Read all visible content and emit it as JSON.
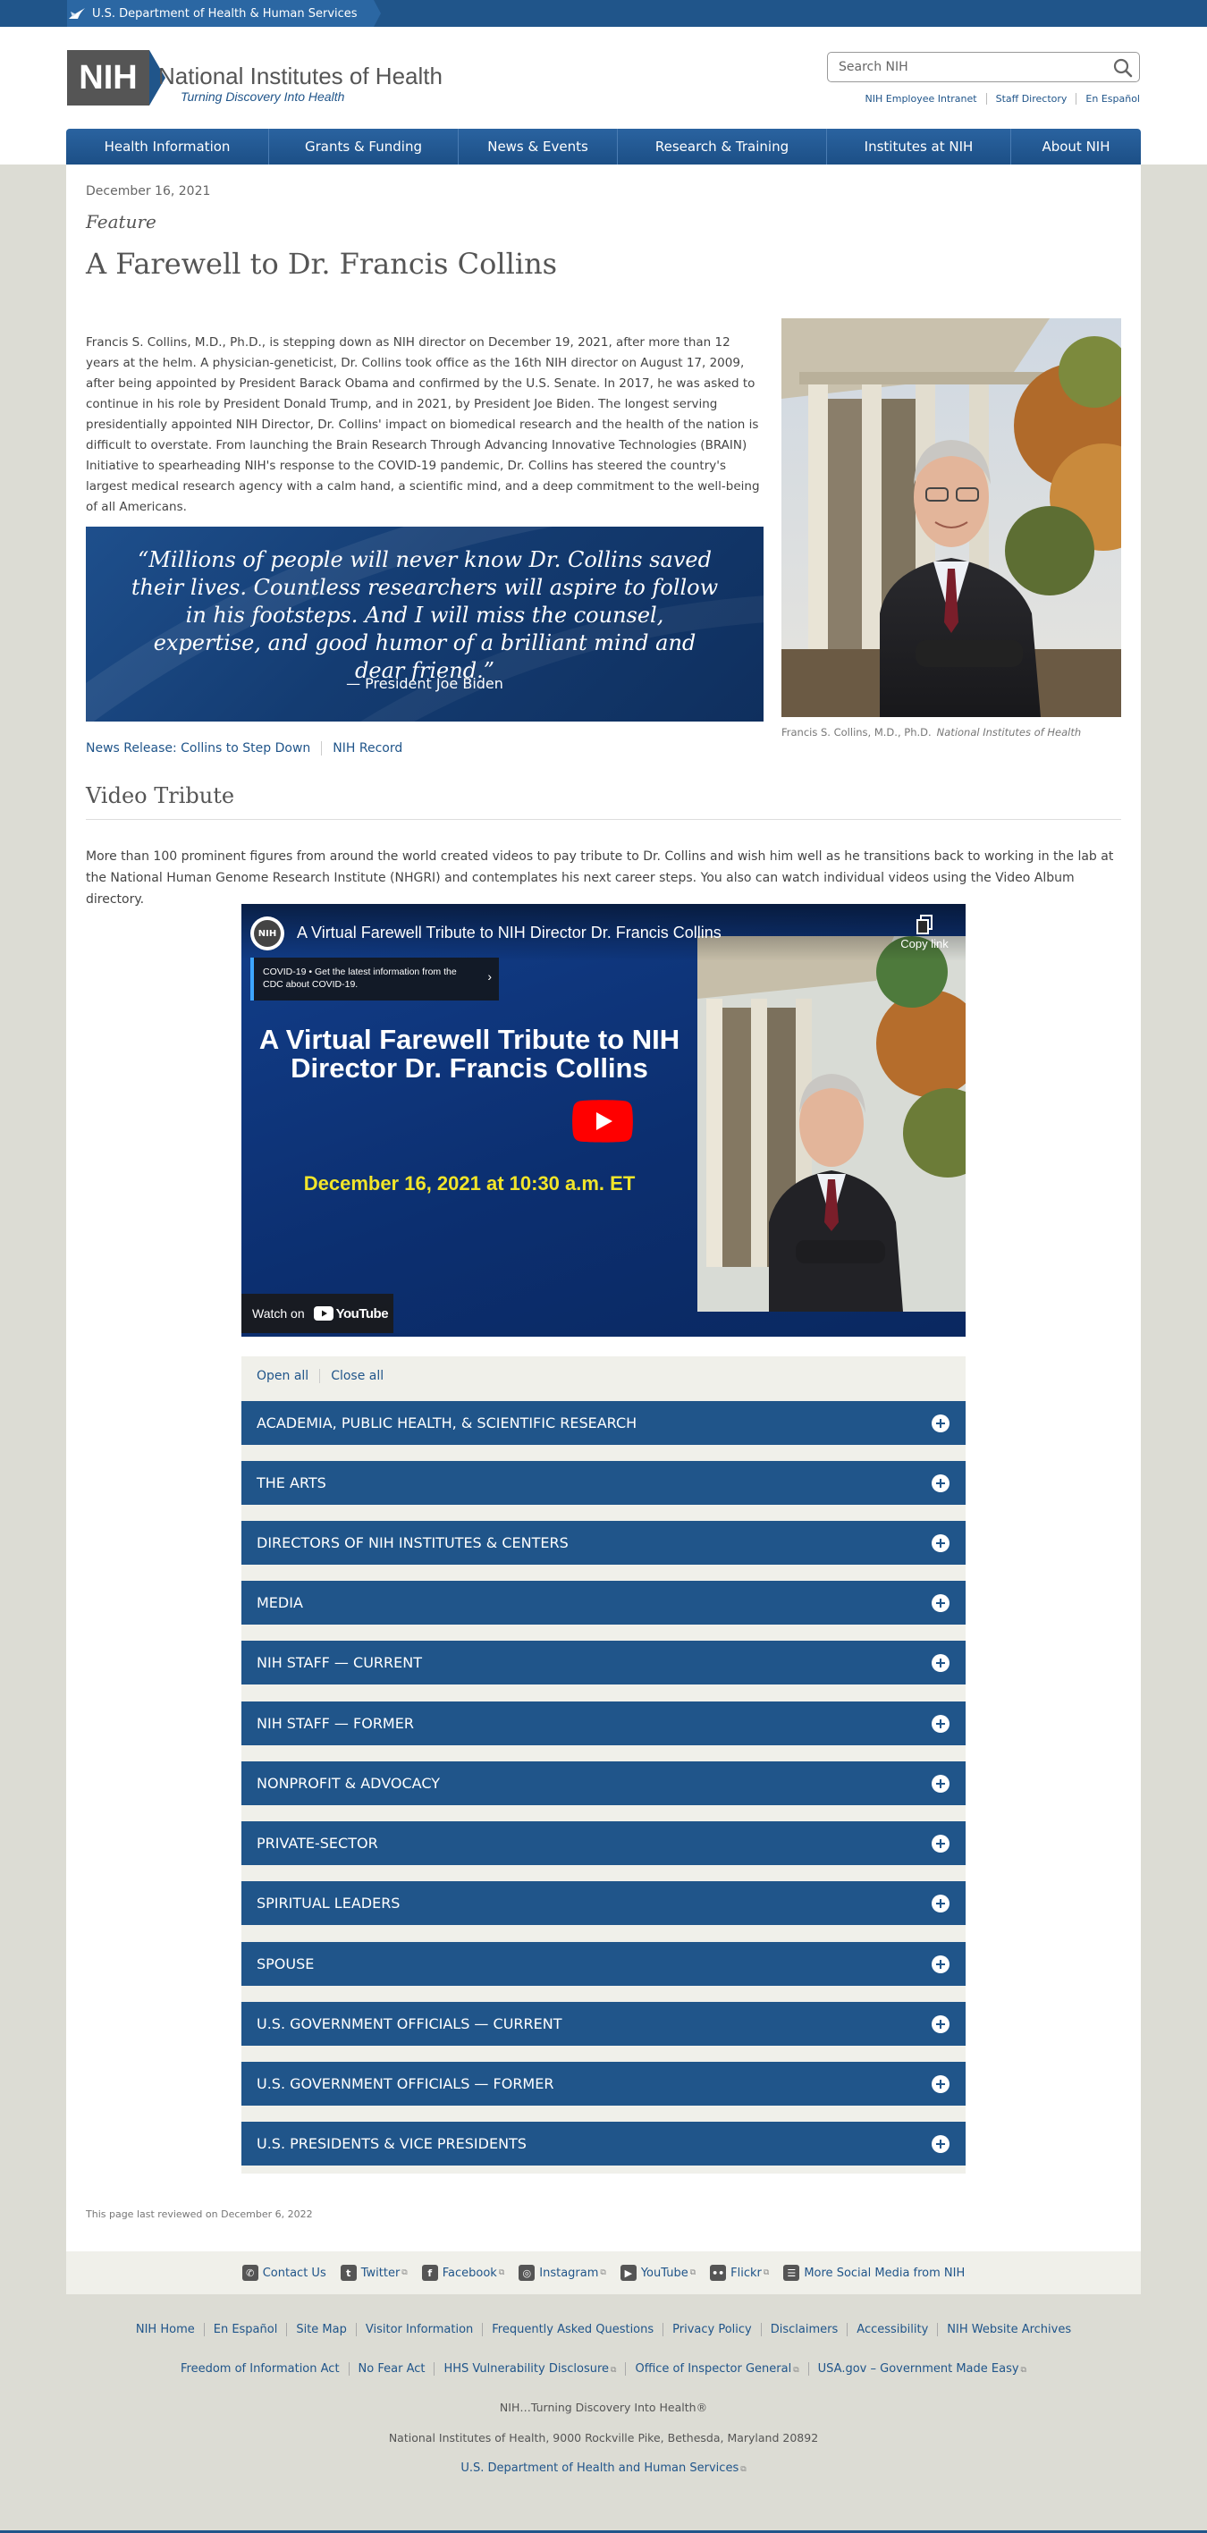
{
  "hhs_bar": {
    "label": "U.S. Department of Health & Human Services"
  },
  "header": {
    "logo_abbr": "NIH",
    "logo_title": "National Institutes of Health",
    "logo_tagline": "Turning Discovery Into Health",
    "search": {
      "placeholder": "Search NIH"
    },
    "utility_links": [
      "NIH Employee Intranet",
      "Staff Directory",
      "En Español"
    ]
  },
  "nav": {
    "items": [
      "Health Information",
      "Grants & Funding",
      "News & Events",
      "Research & Training",
      "Institutes at NIH",
      "About NIH"
    ]
  },
  "article": {
    "date": "December 16, 2021",
    "category": "Feature",
    "title": "A Farewell to Dr. Francis Collins",
    "intro": "Francis S. Collins, M.D., Ph.D., is stepping down as NIH director on December 19, 2021, after more than 12 years at the helm. A physician-geneticist, Dr. Collins took office as the 16th NIH director on August 17, 2009, after being appointed by President Barack Obama and confirmed by the U.S. Senate. In 2017, he was asked to continue in his role by President Donald Trump, and in 2021, by President Joe Biden. The longest serving presidentially appointed NIH Director, Dr. Collins' impact on biomedical research and the health of the nation is difficult to overstate. From launching the Brain Research Through Advancing Innovative Technologies (BRAIN) Initiative to spearheading NIH's response to the COVID-19 pandemic, Dr. Collins has steered the country's largest medical research agency with a calm hand, a scientific mind, and a deep commitment to the well-being of all Americans.",
    "photo_caption": "Francis S. Collins, M.D., Ph.D.",
    "photo_credit": "National Institutes of Health",
    "quote": "“Millions of people will never know Dr. Collins saved their lives. Countless researchers will aspire to follow in his footsteps. And I will miss the counsel, expertise, and good humor of a brilliant mind and dear friend.”",
    "quote_attribution": "— President Joe Biden",
    "links": [
      "News Release: Collins to Step Down",
      "NIH Record"
    ]
  },
  "video_section": {
    "heading": "Video Tribute",
    "text": "More than 100 prominent figures from around the world created videos to pay tribute to Dr. Collins and wish him well as he transitions back to working in the lab at the National Human Genome Research Institute (NHGRI) and contemplates his next career steps. You also can watch individual videos using the Video Album directory.",
    "video": {
      "channel": "NIH",
      "title": "A Virtual Farewell Tribute to NIH Director Dr. Francis Collins",
      "copy_link": "Copy link",
      "covid_banner": "COVID-19 • Get the latest information from the CDC about COVID-19.",
      "headline": "A Virtual Farewell Tribute to NIH Director Dr. Francis Collins",
      "event_date": "December 16, 2021 at 10:30 a.m. ET",
      "watch_on": "Watch on",
      "youtube": "YouTube"
    },
    "accordion_controls": [
      "Open all",
      "Close all"
    ],
    "accordion": [
      "ACADEMIA, PUBLIC HEALTH, & SCIENTIFIC RESEARCH",
      "THE ARTS",
      "DIRECTORS OF NIH INSTITUTES & CENTERS",
      "MEDIA",
      "NIH STAFF — CURRENT",
      "NIH STAFF — FORMER",
      "NONPROFIT & ADVOCACY",
      "PRIVATE-SECTOR",
      "SPIRITUAL LEADERS",
      "SPOUSE",
      "U.S. GOVERNMENT OFFICIALS — CURRENT",
      "U.S. GOVERNMENT OFFICIALS — FORMER",
      "U.S. PRESIDENTS & VICE PRESIDENTS"
    ]
  },
  "reviewed": "This page last reviewed on December 6, 2022",
  "social": [
    {
      "label": "Contact Us",
      "icon": "phone-icon",
      "external": false
    },
    {
      "label": "Twitter",
      "icon": "twitter-icon",
      "external": true
    },
    {
      "label": "Facebook",
      "icon": "facebook-icon",
      "external": true
    },
    {
      "label": "Instagram",
      "icon": "instagram-icon",
      "external": true
    },
    {
      "label": "YouTube",
      "icon": "youtube-icon",
      "external": true
    },
    {
      "label": "Flickr",
      "icon": "flickr-icon",
      "external": true
    },
    {
      "label": "More Social Media from NIH",
      "icon": "social-media-icon",
      "external": false
    }
  ],
  "footer": {
    "row1": [
      "NIH Home",
      "En Español",
      "Site Map",
      "Visitor Information",
      "Frequently Asked Questions",
      "Privacy Policy",
      "Disclaimers",
      "Accessibility",
      "NIH Website Archives"
    ],
    "row2": [
      "Freedom of Information Act",
      "No Fear Act",
      "HHS Vulnerability Disclosure",
      "Office of Inspector General",
      "USA.gov – Government Made Easy"
    ],
    "tagline": "NIH…Turning Discovery Into Health®",
    "address": "National Institutes of Health, 9000 Rockville Pike, Bethesda, Maryland 20892",
    "hhs_link": "U.S. Department of Health and Human Services"
  },
  "colors": {
    "brand_blue": "#20558a",
    "video_date_yellow": "#f2e52a",
    "page_bg": "#dcdcd4"
  }
}
